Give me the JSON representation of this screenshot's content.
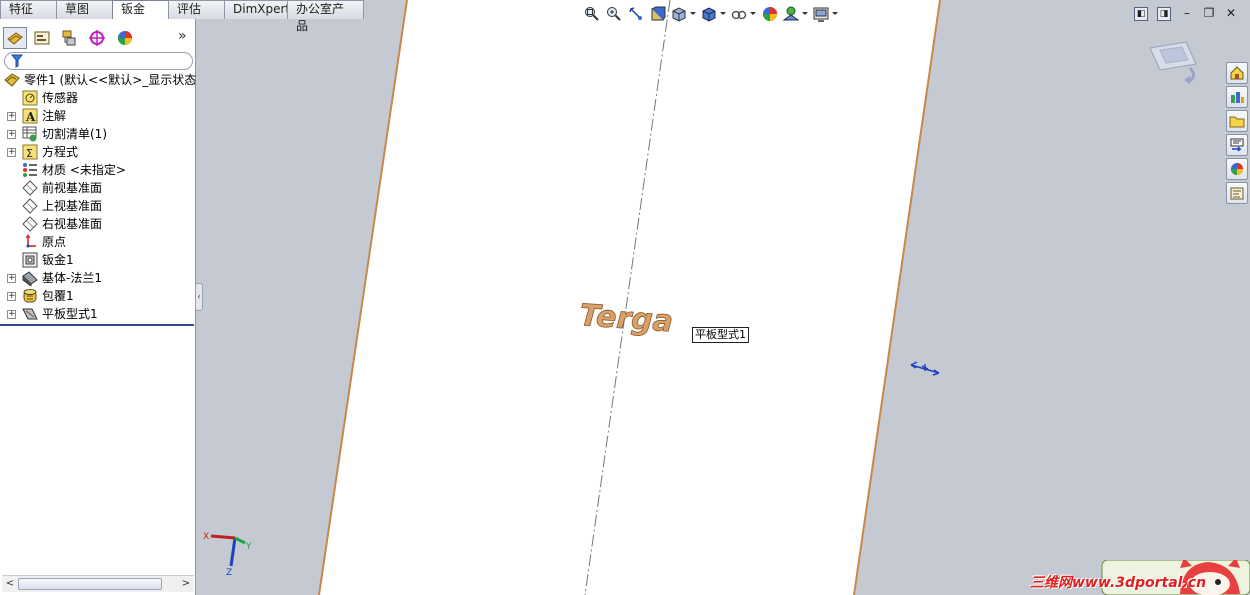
{
  "tabs": [
    "特征",
    "草图",
    "钣金",
    "评估",
    "DimXpert",
    "办公室产品"
  ],
  "active_tab": "钣金",
  "panel": {
    "more_label": "»",
    "tree": {
      "root": "零件1  (默认<<默认>_显示状态",
      "items": [
        {
          "label": "传感器",
          "icon": "sensor-icon",
          "expandable": false
        },
        {
          "label": "注解",
          "icon": "annotation-icon",
          "expandable": true
        },
        {
          "label": "切割清单(1)",
          "icon": "cut-list-icon",
          "expandable": true
        },
        {
          "label": "方程式",
          "icon": "equation-icon",
          "expandable": true
        },
        {
          "label": "材质 <未指定>",
          "icon": "material-icon",
          "expandable": false
        },
        {
          "label": "前视基准面",
          "icon": "plane-icon",
          "expandable": false
        },
        {
          "label": "上视基准面",
          "icon": "plane-icon",
          "expandable": false
        },
        {
          "label": "右视基准面",
          "icon": "plane-icon",
          "expandable": false
        },
        {
          "label": "原点",
          "icon": "origin-icon",
          "expandable": false
        },
        {
          "label": "钣金1",
          "icon": "sheet-metal-icon",
          "expandable": false
        },
        {
          "label": "基体-法兰1",
          "icon": "base-flange-icon",
          "expandable": true
        },
        {
          "label": "包覆1",
          "icon": "wrap-icon",
          "expandable": true
        },
        {
          "label": "平板型式1",
          "icon": "flat-pattern-icon",
          "expandable": true
        }
      ]
    }
  },
  "viewport": {
    "engraved_text": "Terga",
    "callout": "平板型式1",
    "triad": {
      "x": "X",
      "y": "Y",
      "z": "Z"
    }
  },
  "watermark": "三维网www.3dportal.cn",
  "colors": {
    "background": "#c5c9d2",
    "sheet": "#ffffff",
    "sheet_edge": "#c8884a",
    "engraving": "#c08a55",
    "tab_border": "#8f96a6",
    "tree_divider": "#2e4f8c"
  }
}
